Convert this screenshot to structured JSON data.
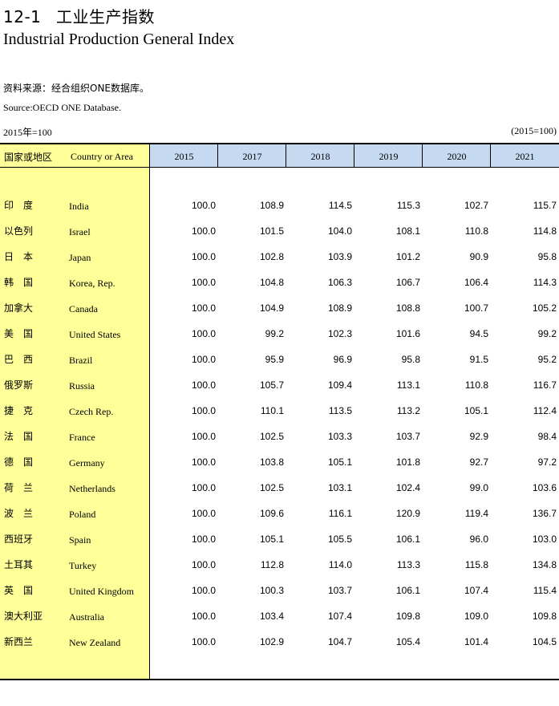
{
  "title_number": "12-1",
  "title_cn": "工业生产指数",
  "title_en": "Industrial Production General Index",
  "source_cn": "资料来源：经合组织ONE数据库。",
  "source_en": "Source:OECD ONE Database.",
  "base_left": "2015年=100",
  "base_right": "(2015=100)",
  "header": {
    "region_cn": "国家或地区",
    "region_en": "Country or Area",
    "years": [
      "2015",
      "2017",
      "2018",
      "2019",
      "2020",
      "2021"
    ]
  },
  "rows": [
    {
      "cn": "印　度",
      "en": "India",
      "values": [
        "100.0",
        "108.9",
        "114.5",
        "115.3",
        "102.7",
        "115.7"
      ]
    },
    {
      "cn": "以色列",
      "en": "Israel",
      "values": [
        "100.0",
        "101.5",
        "104.0",
        "108.1",
        "110.8",
        "114.8"
      ]
    },
    {
      "cn": "日　本",
      "en": "Japan",
      "values": [
        "100.0",
        "102.8",
        "103.9",
        "101.2",
        "90.9",
        "95.8"
      ]
    },
    {
      "cn": "韩　国",
      "en": "Korea, Rep.",
      "values": [
        "100.0",
        "104.8",
        "106.3",
        "106.7",
        "106.4",
        "114.3"
      ]
    },
    {
      "cn": "加拿大",
      "en": "Canada",
      "values": [
        "100.0",
        "104.9",
        "108.9",
        "108.8",
        "100.7",
        "105.2"
      ]
    },
    {
      "cn": "美　国",
      "en": "United States",
      "values": [
        "100.0",
        "99.2",
        "102.3",
        "101.6",
        "94.5",
        "99.2"
      ]
    },
    {
      "cn": "巴　西",
      "en": "Brazil",
      "values": [
        "100.0",
        "95.9",
        "96.9",
        "95.8",
        "91.5",
        "95.2"
      ]
    },
    {
      "cn": "俄罗斯",
      "en": "Russia",
      "values": [
        "100.0",
        "105.7",
        "109.4",
        "113.1",
        "110.8",
        "116.7"
      ]
    },
    {
      "cn": "捷　克",
      "en": "Czech Rep.",
      "values": [
        "100.0",
        "110.1",
        "113.5",
        "113.2",
        "105.1",
        "112.4"
      ]
    },
    {
      "cn": "法　国",
      "en": "France",
      "values": [
        "100.0",
        "102.5",
        "103.3",
        "103.7",
        "92.9",
        "98.4"
      ]
    },
    {
      "cn": "德　国",
      "en": "Germany",
      "values": [
        "100.0",
        "103.8",
        "105.1",
        "101.8",
        "92.7",
        "97.2"
      ]
    },
    {
      "cn": "荷　兰",
      "en": "Netherlands",
      "values": [
        "100.0",
        "102.5",
        "103.1",
        "102.4",
        "99.0",
        "103.6"
      ]
    },
    {
      "cn": "波　兰",
      "en": "Poland",
      "values": [
        "100.0",
        "109.6",
        "116.1",
        "120.9",
        "119.4",
        "136.7"
      ]
    },
    {
      "cn": "西班牙",
      "en": "Spain",
      "values": [
        "100.0",
        "105.1",
        "105.5",
        "106.1",
        "96.0",
        "103.0"
      ]
    },
    {
      "cn": "土耳其",
      "en": "Turkey",
      "values": [
        "100.0",
        "112.8",
        "114.0",
        "113.3",
        "115.8",
        "134.8"
      ]
    },
    {
      "cn": "英　国",
      "en": "United Kingdom",
      "values": [
        "100.0",
        "100.3",
        "103.7",
        "106.1",
        "107.4",
        "115.4"
      ]
    },
    {
      "cn": "澳大利亚",
      "en": "Australia",
      "values": [
        "100.0",
        "103.4",
        "107.4",
        "109.8",
        "109.0",
        "109.8"
      ]
    },
    {
      "cn": "新西兰",
      "en": "New Zealand",
      "values": [
        "100.0",
        "102.9",
        "104.7",
        "105.4",
        "101.4",
        "104.5"
      ]
    }
  ],
  "colors": {
    "label_column_bg": "#ffff99",
    "header_bg": "#c5d9f1"
  }
}
